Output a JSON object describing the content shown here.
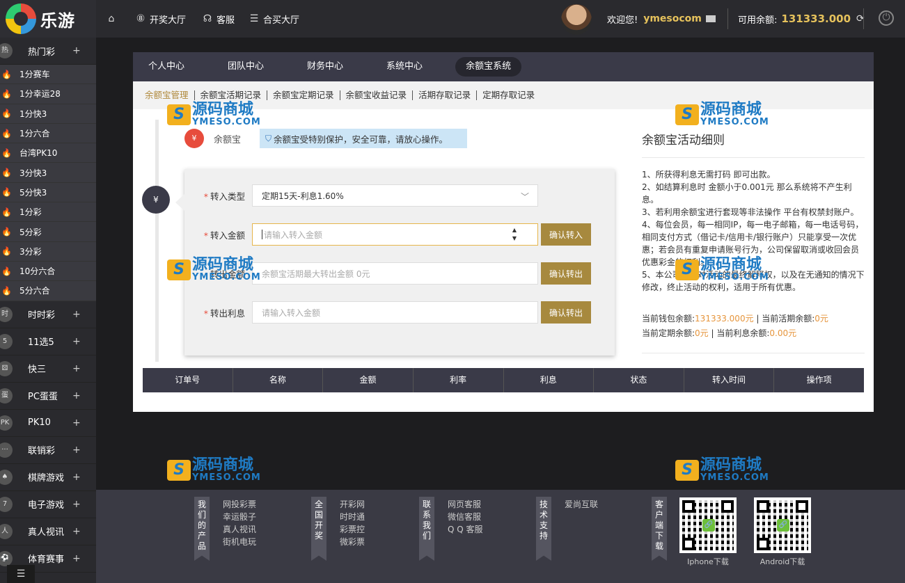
{
  "brand": {
    "name": "乐游"
  },
  "topnav": {
    "home_icon": "home-icon",
    "items": [
      {
        "label": "开奖大厅",
        "icon": "lottery-ball-icon"
      },
      {
        "label": "客服",
        "icon": "headset-icon"
      },
      {
        "label": "合买大厅",
        "icon": "list-icon"
      }
    ]
  },
  "user": {
    "welcome": "欢迎您!",
    "username": "ymesocom",
    "balance_label": "可用余额:",
    "balance": "131333.000"
  },
  "sidebar": {
    "categories": [
      {
        "label": "热门彩",
        "icon": "hot-lottery-icon",
        "expanded": true,
        "items": [
          "1分赛车",
          "1分幸运28",
          "1分快3",
          "1分六合",
          "台湾PK10",
          "3分快3",
          "5分快3",
          "1分彩",
          "5分彩",
          "3分彩",
          "10分六合",
          "5分六合"
        ]
      },
      {
        "label": "时时彩",
        "icon": "ssc-icon"
      },
      {
        "label": "11选5",
        "icon": "11x5-icon"
      },
      {
        "label": "快三",
        "icon": "dice-icon"
      },
      {
        "label": "PC蛋蛋",
        "icon": "pc-egg-icon"
      },
      {
        "label": "PK10",
        "icon": "pk10-icon"
      },
      {
        "label": "联销彩",
        "icon": "more-icon"
      },
      {
        "label": "棋牌游戏",
        "icon": "cards-icon"
      },
      {
        "label": "电子游戏",
        "icon": "slot-icon"
      },
      {
        "label": "真人视讯",
        "icon": "dealer-icon"
      },
      {
        "label": "体育赛事",
        "icon": "football-icon"
      }
    ],
    "plus": "+"
  },
  "main_tabs": [
    "个人中心",
    "团队中心",
    "财务中心",
    "系统中心",
    "余额宝系统"
  ],
  "main_tab_active": 4,
  "sub_tabs": [
    "余额宝管理",
    "余额宝活期记录",
    "余额宝定期记录",
    "余额宝收益记录",
    "活期存取记录",
    "定期存取记录"
  ],
  "sub_tab_active": 0,
  "yeb": {
    "label": "余额宝",
    "notice": "余额宝受特别保护，安全可靠，请放心操作。"
  },
  "form": {
    "type_label": "转入类型",
    "type_value": "定期15天-利息1.60%",
    "in_label": "转入金额",
    "in_placeholder": "请输入转入金额",
    "in_button": "确认转入",
    "out_label": "转出金额",
    "out_placeholder": "余额宝活期最大转出金额 0元",
    "out_button": "确认转出",
    "interest_label": "转出利息",
    "interest_placeholder": "请输入转入金额",
    "interest_button": "确认转出"
  },
  "rules": {
    "title": "余额宝活动细则",
    "items": [
      "1、所获得利息无需打码 即可出款。",
      "2、如结算利息时 金额小于0.001元 那么系统将不产生利息。",
      "3、若利用余额宝进行套现等非法操作 平台有权禁封账户。",
      "4、每位会员，每一相同IP，每一电子邮箱，每一电话号码，相同支付方式（借记卡/信用卡/银行账户）只能享受一次优惠；若会员有重复申请账号行为，公司保留取消或收回会员优惠彩金的权利。",
      "5、本公司保留对活动的最终解释权，以及在无通知的情况下修改，终止活动的权利，适用于所有优惠。"
    ],
    "wallet_label": "当前钱包余额:",
    "wallet_value": "131333.000元",
    "current_label": "当前活期余额:",
    "current_value": "0元",
    "fixed_label": "当前定期余额:",
    "fixed_value": "0元",
    "interest_label": "当前利息余额:",
    "interest_value": "0.00元"
  },
  "table_headers": [
    "订单号",
    "名称",
    "金额",
    "利率",
    "利息",
    "状态",
    "转入时间",
    "操作项"
  ],
  "watermark": {
    "cn": "源码商城",
    "en": "YMESO.COM"
  },
  "footer": {
    "groups": [
      {
        "badge": "我们的产品",
        "links": [
          "网投彩票",
          "幸运骰子",
          "真人视讯",
          "街机电玩"
        ]
      },
      {
        "badge": "全国开奖",
        "links": [
          "开彩网",
          "时时通",
          "彩票控",
          "微彩票"
        ]
      },
      {
        "badge": "联系我们",
        "links": [
          "网页客服",
          "微信客服",
          "Q Q 客服"
        ]
      },
      {
        "badge": "技术支持",
        "links": [
          "爱尚互联"
        ]
      },
      {
        "badge": "客户端下载",
        "links": []
      }
    ],
    "qr": [
      {
        "label": "Iphone下载"
      },
      {
        "label": "Android下载"
      }
    ]
  },
  "colors": {
    "accent": "#a7893e",
    "gold": "#e6c25c",
    "dark": "#3a3a48"
  }
}
